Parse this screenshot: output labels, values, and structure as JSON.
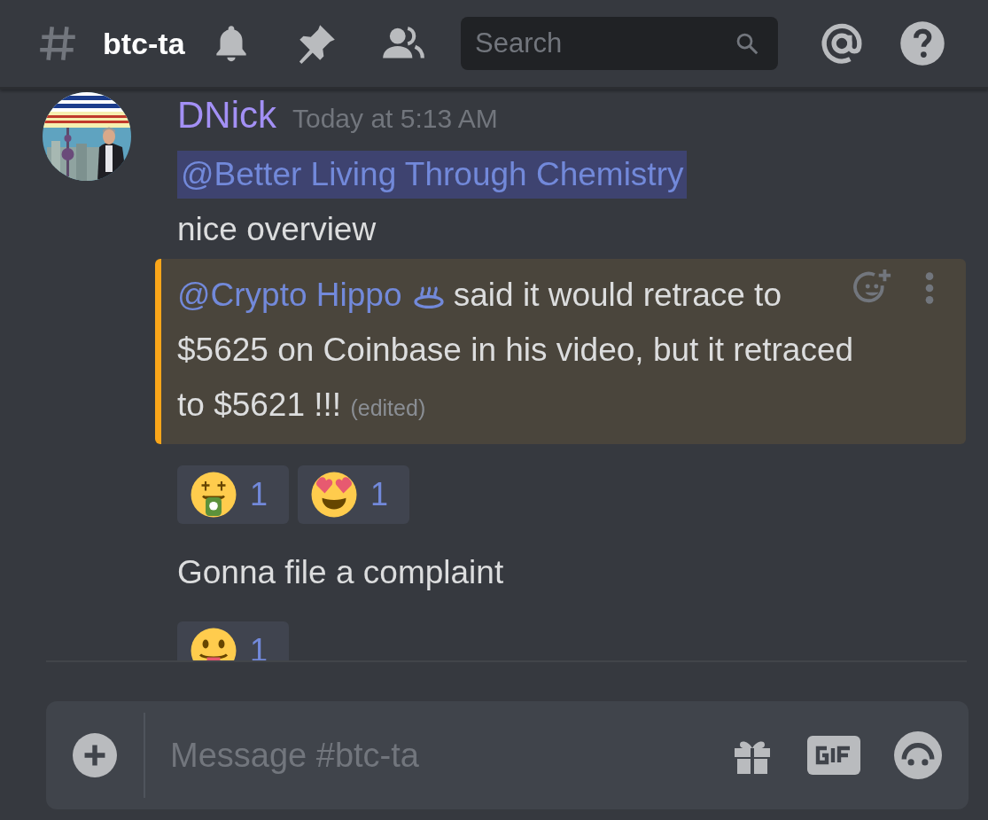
{
  "header": {
    "channel_name": "btc-ta",
    "search": {
      "placeholder": "Search"
    }
  },
  "messages": [
    {
      "author": "DNick",
      "timestamp": "Today at 5:13 AM",
      "blocks": [
        {
          "kind": "mention_line",
          "mention": "@Better Living Through Chemistry"
        },
        {
          "kind": "text",
          "text": "nice overview"
        },
        {
          "kind": "highlighted",
          "mention": "@Crypto Hippo",
          "text": "said it would retrace to $5625 on Coinbase in his video, but it retraced to $5621 !!!",
          "edited": "(edited)",
          "reactions": [
            {
              "kind": "money_mouth",
              "count": "1",
              "selected": false
            },
            {
              "kind": "heart_eyes",
              "count": "1",
              "selected": false
            }
          ]
        },
        {
          "kind": "text",
          "text": "Gonna file a complaint",
          "reactions": [
            {
              "kind": "tongue",
              "count": "1",
              "selected": false
            }
          ]
        }
      ]
    }
  ],
  "composer": {
    "placeholder": "Message #btc-ta"
  }
}
